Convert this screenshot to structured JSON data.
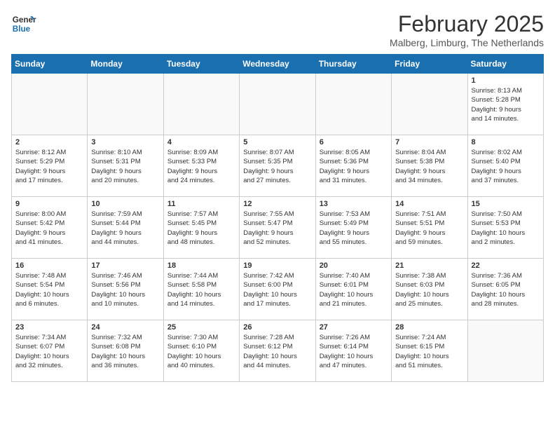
{
  "logo": {
    "line1": "General",
    "line2": "Blue"
  },
  "title": "February 2025",
  "subtitle": "Malberg, Limburg, The Netherlands",
  "weekdays": [
    "Sunday",
    "Monday",
    "Tuesday",
    "Wednesday",
    "Thursday",
    "Friday",
    "Saturday"
  ],
  "weeks": [
    [
      {
        "day": "",
        "info": ""
      },
      {
        "day": "",
        "info": ""
      },
      {
        "day": "",
        "info": ""
      },
      {
        "day": "",
        "info": ""
      },
      {
        "day": "",
        "info": ""
      },
      {
        "day": "",
        "info": ""
      },
      {
        "day": "1",
        "info": "Sunrise: 8:13 AM\nSunset: 5:28 PM\nDaylight: 9 hours\nand 14 minutes."
      }
    ],
    [
      {
        "day": "2",
        "info": "Sunrise: 8:12 AM\nSunset: 5:29 PM\nDaylight: 9 hours\nand 17 minutes."
      },
      {
        "day": "3",
        "info": "Sunrise: 8:10 AM\nSunset: 5:31 PM\nDaylight: 9 hours\nand 20 minutes."
      },
      {
        "day": "4",
        "info": "Sunrise: 8:09 AM\nSunset: 5:33 PM\nDaylight: 9 hours\nand 24 minutes."
      },
      {
        "day": "5",
        "info": "Sunrise: 8:07 AM\nSunset: 5:35 PM\nDaylight: 9 hours\nand 27 minutes."
      },
      {
        "day": "6",
        "info": "Sunrise: 8:05 AM\nSunset: 5:36 PM\nDaylight: 9 hours\nand 31 minutes."
      },
      {
        "day": "7",
        "info": "Sunrise: 8:04 AM\nSunset: 5:38 PM\nDaylight: 9 hours\nand 34 minutes."
      },
      {
        "day": "8",
        "info": "Sunrise: 8:02 AM\nSunset: 5:40 PM\nDaylight: 9 hours\nand 37 minutes."
      }
    ],
    [
      {
        "day": "9",
        "info": "Sunrise: 8:00 AM\nSunset: 5:42 PM\nDaylight: 9 hours\nand 41 minutes."
      },
      {
        "day": "10",
        "info": "Sunrise: 7:59 AM\nSunset: 5:44 PM\nDaylight: 9 hours\nand 44 minutes."
      },
      {
        "day": "11",
        "info": "Sunrise: 7:57 AM\nSunset: 5:45 PM\nDaylight: 9 hours\nand 48 minutes."
      },
      {
        "day": "12",
        "info": "Sunrise: 7:55 AM\nSunset: 5:47 PM\nDaylight: 9 hours\nand 52 minutes."
      },
      {
        "day": "13",
        "info": "Sunrise: 7:53 AM\nSunset: 5:49 PM\nDaylight: 9 hours\nand 55 minutes."
      },
      {
        "day": "14",
        "info": "Sunrise: 7:51 AM\nSunset: 5:51 PM\nDaylight: 9 hours\nand 59 minutes."
      },
      {
        "day": "15",
        "info": "Sunrise: 7:50 AM\nSunset: 5:53 PM\nDaylight: 10 hours\nand 2 minutes."
      }
    ],
    [
      {
        "day": "16",
        "info": "Sunrise: 7:48 AM\nSunset: 5:54 PM\nDaylight: 10 hours\nand 6 minutes."
      },
      {
        "day": "17",
        "info": "Sunrise: 7:46 AM\nSunset: 5:56 PM\nDaylight: 10 hours\nand 10 minutes."
      },
      {
        "day": "18",
        "info": "Sunrise: 7:44 AM\nSunset: 5:58 PM\nDaylight: 10 hours\nand 14 minutes."
      },
      {
        "day": "19",
        "info": "Sunrise: 7:42 AM\nSunset: 6:00 PM\nDaylight: 10 hours\nand 17 minutes."
      },
      {
        "day": "20",
        "info": "Sunrise: 7:40 AM\nSunset: 6:01 PM\nDaylight: 10 hours\nand 21 minutes."
      },
      {
        "day": "21",
        "info": "Sunrise: 7:38 AM\nSunset: 6:03 PM\nDaylight: 10 hours\nand 25 minutes."
      },
      {
        "day": "22",
        "info": "Sunrise: 7:36 AM\nSunset: 6:05 PM\nDaylight: 10 hours\nand 28 minutes."
      }
    ],
    [
      {
        "day": "23",
        "info": "Sunrise: 7:34 AM\nSunset: 6:07 PM\nDaylight: 10 hours\nand 32 minutes."
      },
      {
        "day": "24",
        "info": "Sunrise: 7:32 AM\nSunset: 6:08 PM\nDaylight: 10 hours\nand 36 minutes."
      },
      {
        "day": "25",
        "info": "Sunrise: 7:30 AM\nSunset: 6:10 PM\nDaylight: 10 hours\nand 40 minutes."
      },
      {
        "day": "26",
        "info": "Sunrise: 7:28 AM\nSunset: 6:12 PM\nDaylight: 10 hours\nand 44 minutes."
      },
      {
        "day": "27",
        "info": "Sunrise: 7:26 AM\nSunset: 6:14 PM\nDaylight: 10 hours\nand 47 minutes."
      },
      {
        "day": "28",
        "info": "Sunrise: 7:24 AM\nSunset: 6:15 PM\nDaylight: 10 hours\nand 51 minutes."
      },
      {
        "day": "",
        "info": ""
      }
    ]
  ]
}
